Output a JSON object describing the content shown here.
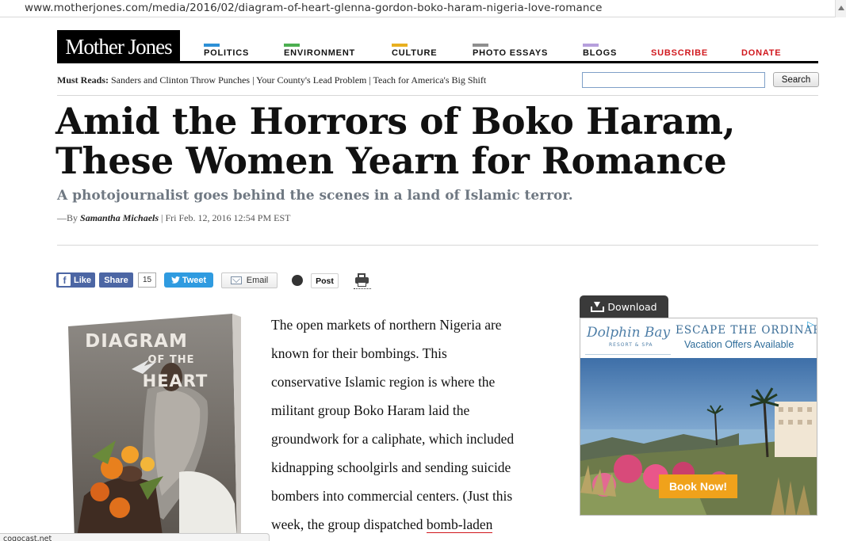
{
  "browser": {
    "url": "www.motherjones.com/media/2016/02/diagram-of-heart-glenna-gordon-boko-haram-nigeria-love-romance",
    "status_text": "cogocast.net"
  },
  "site": {
    "logo_text": "Mother Jones",
    "nav": [
      {
        "label": "POLITICS",
        "color": "#2d90d6"
      },
      {
        "label": "ENVIRONMENT",
        "color": "#4caf50"
      },
      {
        "label": "CULTURE",
        "color": "#e8b020"
      },
      {
        "label": "PHOTO ESSAYS",
        "color": "#8f8f8f"
      },
      {
        "label": "BLOGS",
        "color": "#b69fdc"
      },
      {
        "label": "SUBSCRIBE",
        "color": "#d1181e"
      },
      {
        "label": "DONATE",
        "color": "#d1181e"
      }
    ]
  },
  "must_reads": {
    "label": "Must Reads:",
    "items": [
      "Sanders and Clinton Throw Punches",
      "Your County's Lead Problem",
      "Teach for America's Big Shift"
    ],
    "separator": " | "
  },
  "search": {
    "value": "",
    "button_label": "Search"
  },
  "article": {
    "headline_line1": "Amid the Horrors of Boko Haram,",
    "headline_line2": "These Women Yearn for Romance",
    "dek": "A photojournalist goes behind the scenes in a land of Islamic terror.",
    "byline_prefix": "—By",
    "author": "Samantha Michaels",
    "byline_separator": " | ",
    "date": "Fri Feb. 12, 2016 12:54 PM EST",
    "body_lines": [
      "The open markets of northern Nigeria are",
      "known for their bombings. This",
      "conservative Islamic region is where the",
      "militant group Boko Haram laid the",
      "groundwork for a caliphate, which included",
      "kidnapping schoolgirls and sending suicide",
      "bombers into commercial centers. (Just this"
    ],
    "last_line_prefix": "week, the group dispatched ",
    "last_line_link": "bomb-laden"
  },
  "book_cover": {
    "title_line1": "DIAGRAM",
    "title_line2": "OF THE",
    "title_line3": "HEART"
  },
  "share": {
    "like_label": "Like",
    "share_label": "Share",
    "share_count": "15",
    "tweet_label": "Tweet",
    "email_label": "Email",
    "post_label": "Post"
  },
  "ad": {
    "download_label": "Download",
    "logo_line1": "Dolphin Bay",
    "logo_line2": "RESORT & SPA",
    "headline": "ESCAPE THE ORDINARY",
    "subline": "Vacation Offers Available",
    "cta": "Book Now!",
    "cta_color": "#f0a21b"
  }
}
